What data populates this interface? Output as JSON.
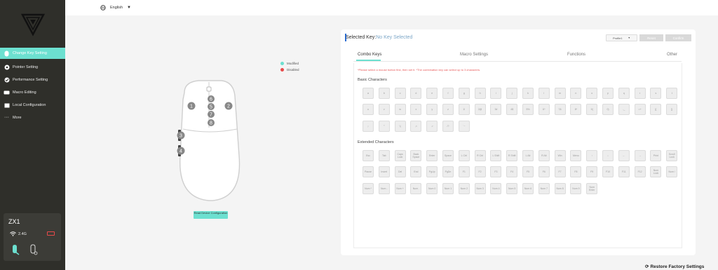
{
  "sidebar": {
    "items": [
      {
        "label": "Change Key Setting",
        "icon": "mouse-icon",
        "active": true
      },
      {
        "label": "Pointer Setting",
        "icon": "pointer-icon",
        "active": false
      },
      {
        "label": "Performance Setting",
        "icon": "gauge-icon",
        "active": false
      },
      {
        "label": "Macro Editing",
        "icon": "keyboard-icon",
        "active": false
      },
      {
        "label": "Local Configuration",
        "icon": "folder-icon",
        "active": false
      },
      {
        "label": "More",
        "icon": "more-icon",
        "active": false
      }
    ],
    "device": {
      "name": "ZX1",
      "connection": "2.4G"
    }
  },
  "topbar": {
    "language": "English"
  },
  "mouse": {
    "legend": {
      "modified": "Modified",
      "disabled": "Disabled"
    },
    "button_labels": [
      "1",
      "2",
      "3",
      "4",
      "5",
      "6",
      "7",
      "8"
    ],
    "read_button": "Read Device Configuration"
  },
  "panel": {
    "selected_key_label": "Selected Key:",
    "selected_key_value": "No Key Selected",
    "profile": "Profile1",
    "reset": "Reset",
    "confirm": "Confirm",
    "tabs": [
      "Combo Keys",
      "Macro Settings",
      "Functions",
      "Other"
    ],
    "hint": "*Please select a mouse button first, then set it.     *The combination key can select up to 3 characters.",
    "basic_title": "Basic Characters",
    "extended_title": "Extended Characters",
    "basic_rows": [
      [
        "a",
        "b",
        "c",
        "d",
        "e",
        "f",
        "g",
        "h",
        "i",
        "j",
        "k",
        "l",
        "m",
        "n",
        "o",
        "p",
        "q",
        "r",
        "s",
        "t"
      ],
      [
        "u",
        "v",
        "w",
        "x",
        "y",
        "z",
        "1!",
        "2@",
        "3#",
        "4$",
        "5%",
        "6^",
        "7&",
        "8*",
        "9(",
        "0)",
        "-_",
        "=+",
        "[{",
        "]}"
      ],
      [
        ";:",
        "'\"",
        "\\|",
        ",<",
        ".>",
        "/?",
        "`~"
      ]
    ],
    "extended_rows": [
      [
        "Esc",
        "Tab",
        "Caps Lock",
        "Back Space",
        "Enter",
        "Space",
        "L Ctrl",
        "R Ctrl",
        "L Shift",
        "R Shift",
        "L Alt",
        "R Alt",
        "Win",
        "Menu",
        "↑",
        "↓",
        "←",
        "→",
        "Print",
        "Scroll Lock"
      ],
      [
        "Pause",
        "Insert",
        "Del",
        "End",
        "PgUp",
        "PgDn",
        "F1",
        "F2",
        "F3",
        "F4",
        "F5",
        "F6",
        "F7",
        "F8",
        "F9",
        "F10",
        "F11",
        "F12",
        "Num Lock",
        "Num /"
      ],
      [
        "Num *",
        "Num -",
        "Num +",
        "Num .",
        "Num 0",
        "Num 1",
        "Num 2",
        "Num 3",
        "Num 4",
        "Num 5",
        "Num 6",
        "Num 7",
        "Num 8",
        "Num 9",
        "Num Enter"
      ]
    ]
  },
  "footer": {
    "restore": "Restore Factory Settings"
  },
  "colors": {
    "accent": "#6ce0d0",
    "sidebar": "#2f2f2a",
    "modified": "#6ce0d0",
    "disabled": "#e84a4a",
    "hint": "#e85a5a"
  }
}
